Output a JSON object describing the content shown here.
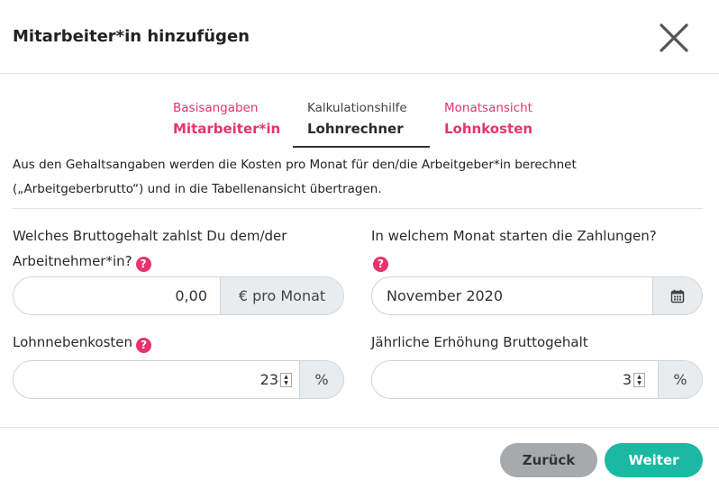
{
  "dialog": {
    "title": "Mitarbeiter*in hinzufügen"
  },
  "steps": [
    {
      "sub": "Basisangaben",
      "main": "Mitarbeiter*in"
    },
    {
      "sub": "Kalkulationshilfe",
      "main": "Lohnrechner"
    },
    {
      "sub": "Monatsansicht",
      "main": "Lohnkosten"
    }
  ],
  "intro": {
    "line1": "Aus den Gehaltsangaben werden die Kosten pro Monat für den/die Arbeitgeber*in berechnet",
    "line2": "(„Arbeitgeberbrutto“) und in die Tabellenansicht übertragen."
  },
  "fields": {
    "salary": {
      "label_line1": "Welches Bruttogehalt zahlst Du dem/der",
      "label_line2": "Arbeitnehmer*in?",
      "value": "0,00",
      "addon": "€ pro Monat"
    },
    "start_month": {
      "label": "In welchem Monat starten die Zahlungen?",
      "value": "November 2020"
    },
    "additional_costs": {
      "label": "Lohnnebenkosten",
      "value": "23",
      "addon": "%"
    },
    "annual_increase": {
      "label": "Jährliche Erhöhung Bruttogehalt",
      "value": "3",
      "addon": "%"
    }
  },
  "help_glyph": "?",
  "buttons": {
    "back": "Zurück",
    "next": "Weiter"
  },
  "icons": {
    "close": "close-icon",
    "calendar": "calendar-icon",
    "help": "help-icon"
  },
  "colors": {
    "accent_pink": "#e8336d",
    "primary_teal": "#1bb9a3",
    "secondary_gray": "#a7aaad"
  }
}
